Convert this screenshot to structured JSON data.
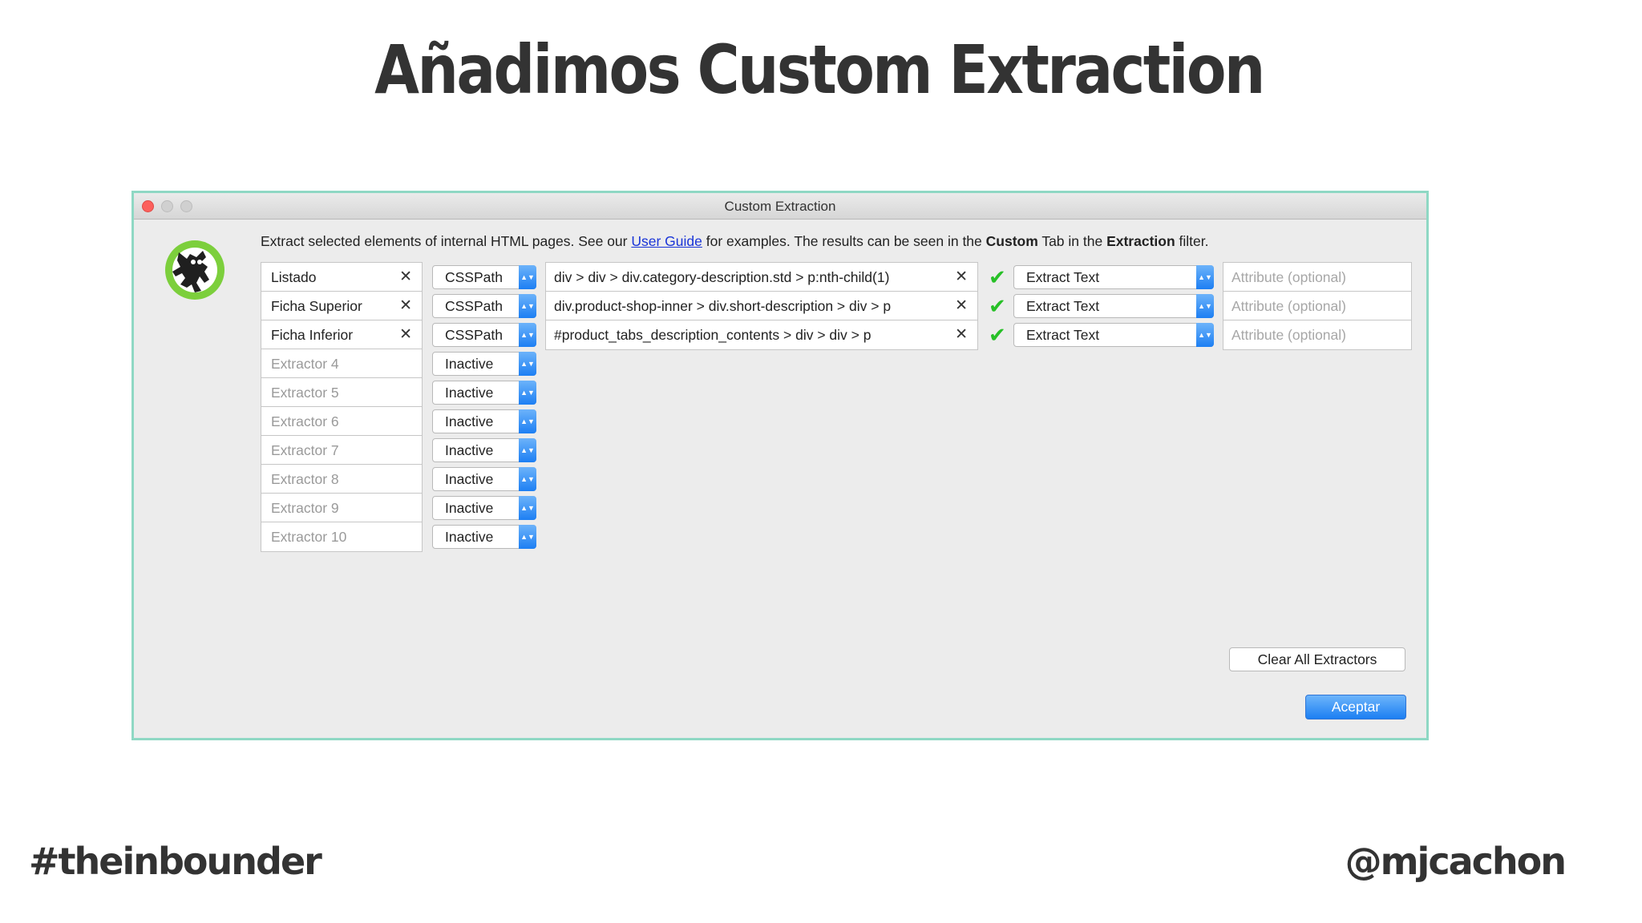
{
  "slide": {
    "title": "Añadimos Custom Extraction",
    "footer_left": "#theinbounder",
    "footer_right": "@mjcachon"
  },
  "window": {
    "title": "Custom Extraction",
    "intro": {
      "before_link": "Extract selected elements of internal HTML pages. See our ",
      "link": "User Guide",
      "middle": " for examples. The results can be seen in the ",
      "bold1": "Custom",
      "middle2": " Tab in the ",
      "bold2": "Extraction",
      "after": " filter."
    },
    "logo": "screaming-frog-icon",
    "active_extractors": [
      {
        "name": "Listado",
        "type": "CSSPath",
        "path": "div > div > div.category-description.std > p:nth-child(1)",
        "extract": "Extract Text",
        "attribute_placeholder": "Attribute (optional)"
      },
      {
        "name": "Ficha Superior",
        "type": "CSSPath",
        "path": "div.product-shop-inner > div.short-description > div > p",
        "extract": "Extract Text",
        "attribute_placeholder": "Attribute (optional)"
      },
      {
        "name": "Ficha Inferior",
        "type": "CSSPath",
        "path": "#product_tabs_description_contents > div > div > p",
        "extract": "Extract Text",
        "attribute_placeholder": "Attribute (optional)"
      }
    ],
    "inactive_extractors": [
      {
        "name": "Extractor 4",
        "type": "Inactive"
      },
      {
        "name": "Extractor 5",
        "type": "Inactive"
      },
      {
        "name": "Extractor 6",
        "type": "Inactive"
      },
      {
        "name": "Extractor 7",
        "type": "Inactive"
      },
      {
        "name": "Extractor 8",
        "type": "Inactive"
      },
      {
        "name": "Extractor 9",
        "type": "Inactive"
      },
      {
        "name": "Extractor 10",
        "type": "Inactive"
      }
    ],
    "buttons": {
      "clear_all": "Clear All Extractors",
      "ok": "Aceptar"
    },
    "colors": {
      "accent": "#1d7ff3",
      "valid_check": "#27c027",
      "window_border": "#8fd8c4",
      "link": "#1a35d8"
    }
  }
}
